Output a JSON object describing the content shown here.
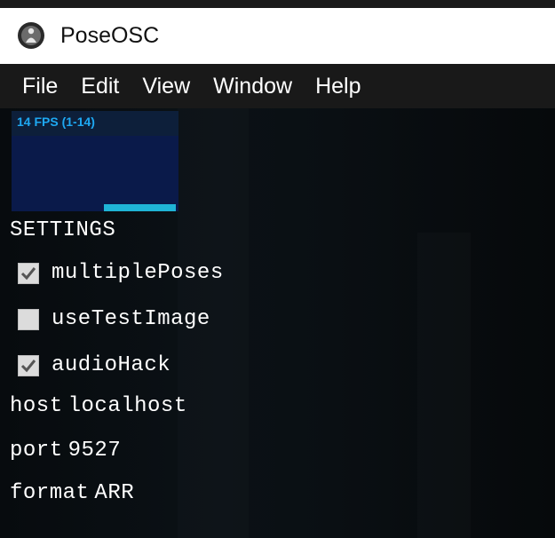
{
  "window": {
    "title": "PoseOSC"
  },
  "menu": [
    "File",
    "Edit",
    "View",
    "Window",
    "Help"
  ],
  "stats": {
    "fps_text": "14 FPS (1-14)",
    "fill_fraction": 0.43
  },
  "settings": {
    "header": "SETTINGS",
    "checkboxes": [
      {
        "label": "multiplePoses",
        "checked": true
      },
      {
        "label": "useTestImage",
        "checked": false
      },
      {
        "label": "audioHack",
        "checked": true
      }
    ],
    "fields": [
      {
        "label": "host",
        "value": "localhost"
      },
      {
        "label": "port",
        "value": "9527"
      },
      {
        "label": "format",
        "value": "ARR"
      }
    ]
  },
  "colors": {
    "menubar": "#191919",
    "content_bg": "#0a0f13",
    "stats_text": "#1ea8f2",
    "stats_graph": "#0a1a4a",
    "stats_fill": "#1fb4d6"
  },
  "icons": {
    "app": "poseosc-app-icon",
    "check": "checkmark-icon"
  }
}
